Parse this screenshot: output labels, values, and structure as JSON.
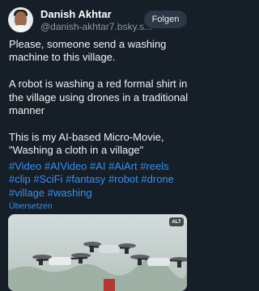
{
  "post": {
    "author_name": "Danish Akhtar",
    "author_handle": "@danish-akhtar7.bsky.s...",
    "follow_label": "Folgen",
    "paragraphs": [
      "Please, someone send a washing machine to this village.",
      "A robot is washing a red formal shirt in the village using drones in a traditional manner",
      "This is my AI-based Micro-Movie, \"Washing a cloth in a village\""
    ],
    "hashtags": [
      "#Video",
      "#AIVideo",
      "#AI",
      "#AiArt",
      "#reels",
      "#clip",
      "#SciFi",
      "#fantasy",
      "#robot",
      "#drone",
      "#village",
      "#washing"
    ],
    "translate_label": "Übersetzen",
    "media": {
      "alt_badge": "ALT",
      "icon": "drone-video-thumbnail"
    }
  },
  "colors": {
    "background": "#161e27",
    "link": "#3b8ff0",
    "follow_button_bg": "#2c3847",
    "secondary_text": "#8d97a3"
  }
}
